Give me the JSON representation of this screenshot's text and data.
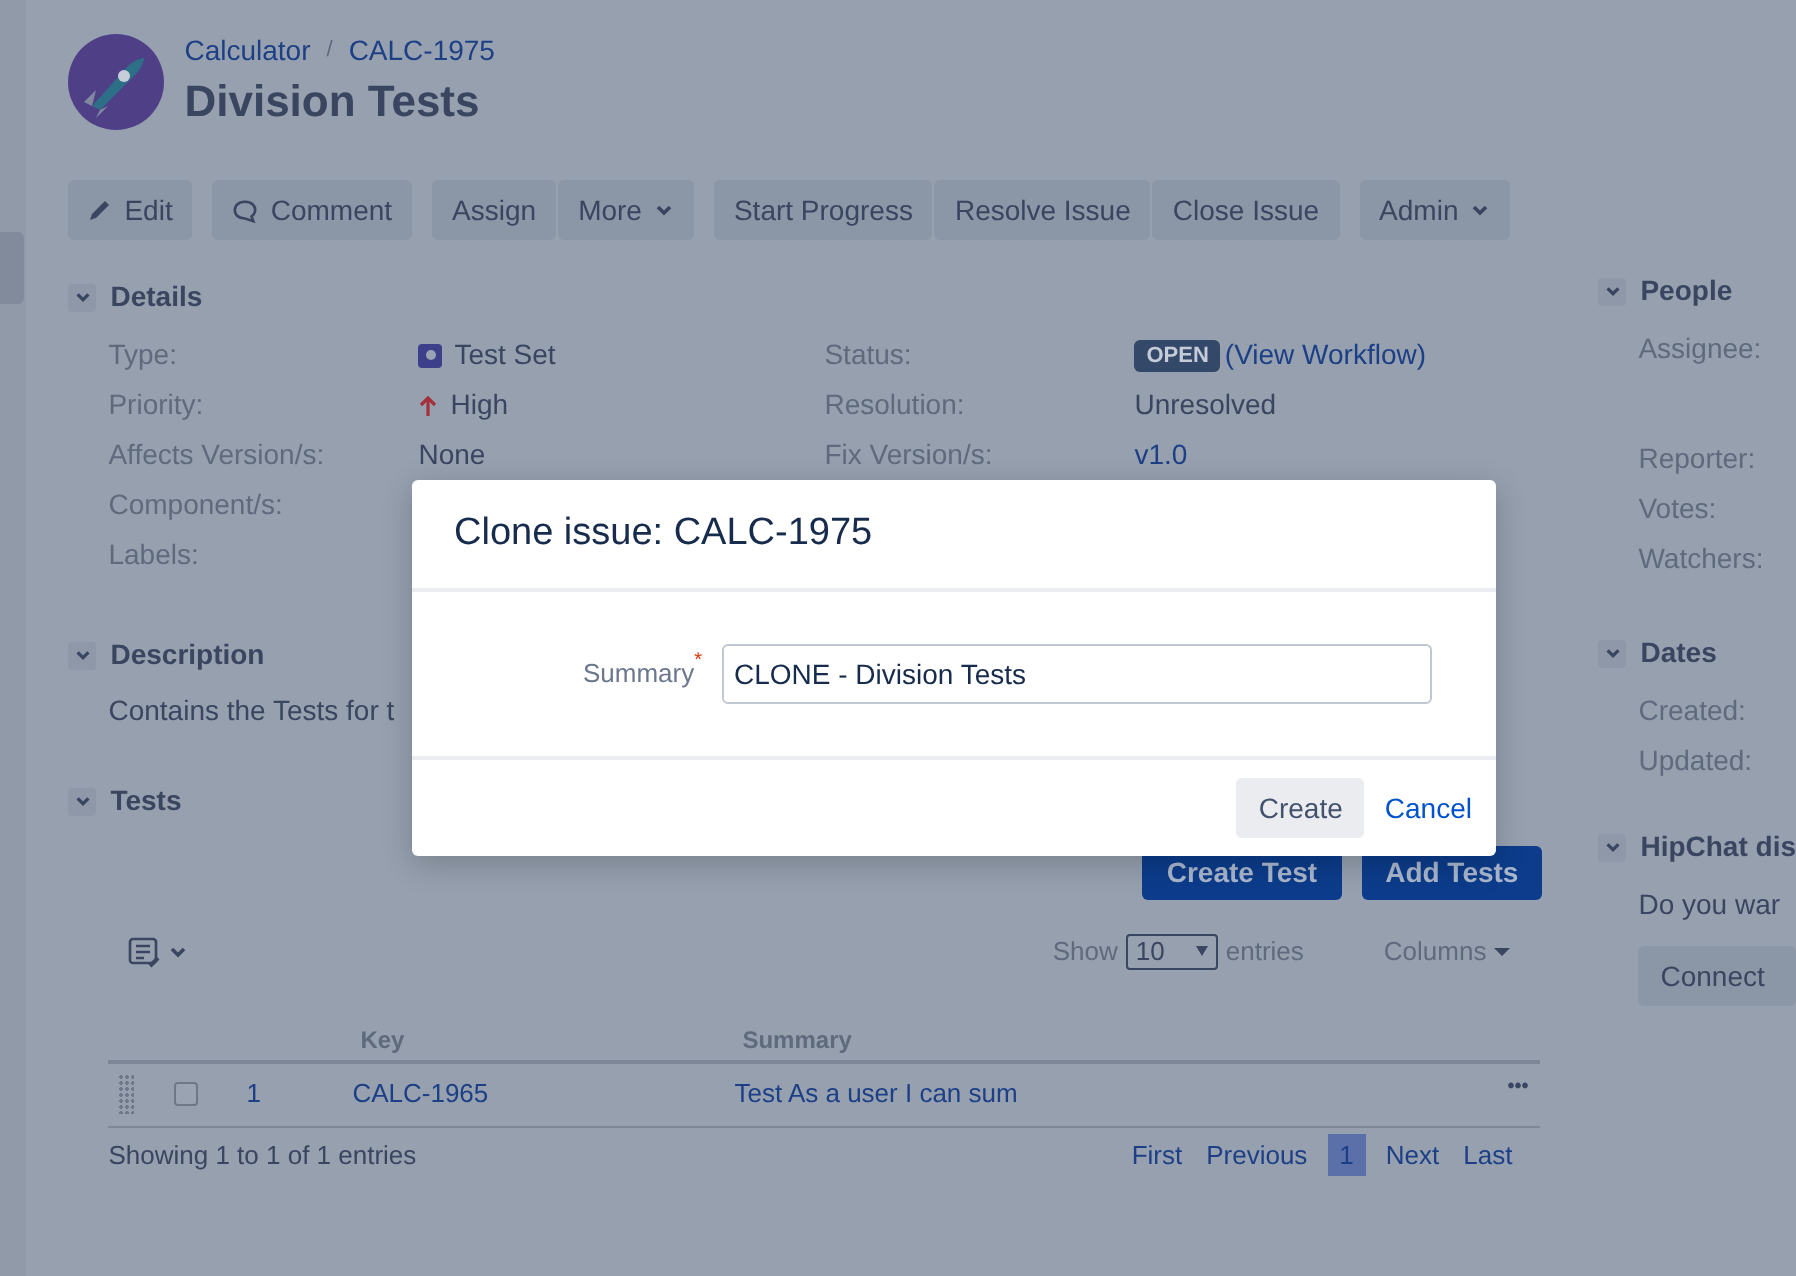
{
  "breadcrumb": {
    "project": "Calculator",
    "separator": "/",
    "issue_key": "CALC-1975"
  },
  "title": "Division Tests",
  "toolbar": [
    {
      "label": "Edit",
      "kind": "edit",
      "caret": false
    },
    {
      "label": "Comment",
      "kind": "comment",
      "caret": false
    },
    {
      "label": "Assign",
      "kind": "plain",
      "caret": false
    },
    {
      "label": "More",
      "kind": "plain",
      "caret": true
    },
    {
      "label": "Start Progress",
      "kind": "plain",
      "caret": false
    },
    {
      "label": "Resolve Issue",
      "kind": "plain",
      "caret": false
    },
    {
      "label": "Close Issue",
      "kind": "plain",
      "caret": false
    },
    {
      "label": "Admin",
      "kind": "plain",
      "caret": true
    }
  ],
  "details": {
    "heading": "Details",
    "expanded": true,
    "left": [
      {
        "label": "Type:",
        "value": "Test Set",
        "kind": "type"
      },
      {
        "label": "Priority:",
        "value": "High",
        "kind": "priority"
      },
      {
        "label": "Affects Version/s:",
        "value": "None",
        "kind": "text"
      },
      {
        "label": "Component/s:"
      },
      {
        "label": "Labels:"
      }
    ],
    "right": [
      {
        "label": "Status:",
        "value": "OPEN",
        "link": "(View Workflow)",
        "kind": "status"
      },
      {
        "label": "Resolution:",
        "value": "Unresolved",
        "kind": "text"
      },
      {
        "label": "Fix Version/s:",
        "value": "v1.0",
        "kind": "link"
      }
    ]
  },
  "description": {
    "heading": "Description",
    "expanded": true,
    "text": "Contains the Tests for t"
  },
  "tests": {
    "heading": "Tests",
    "expanded": true,
    "buttons": [
      "Create Test",
      "Add Tests"
    ],
    "show_label": "Show",
    "page_size": "10",
    "entries_label": "entries",
    "columns_button": "Columns",
    "columns": [
      "Key",
      "Summary"
    ],
    "rows": [
      {
        "checked": false,
        "rank": "1",
        "key": "CALC-1965",
        "summary": "Test As a user I can sum",
        "more": "•••"
      }
    ],
    "info": "Showing 1 to 1 of 1 entries",
    "pagination": [
      {
        "label": "First",
        "selected": false
      },
      {
        "label": "Previous",
        "selected": false
      },
      {
        "label": "1",
        "selected": true
      },
      {
        "label": "Next",
        "selected": false
      },
      {
        "label": "Last",
        "selected": false
      }
    ]
  },
  "people": {
    "heading": "People",
    "expanded": true,
    "fields": [
      "Assignee:",
      "Reporter:",
      "Votes:",
      "Watchers:"
    ]
  },
  "dates": {
    "heading": "Dates",
    "expanded": true,
    "fields": [
      "Created:",
      "Updated:"
    ]
  },
  "hipchat": {
    "heading": "HipChat dis",
    "expanded": true,
    "text": "Do you war",
    "button": "Connect"
  },
  "dialog": {
    "title": "Clone issue: CALC-1975",
    "field_label": "Summary",
    "required_mark": "*",
    "field_value": "CLONE - Division Tests",
    "buttons": [
      "Create",
      "Cancel"
    ]
  }
}
